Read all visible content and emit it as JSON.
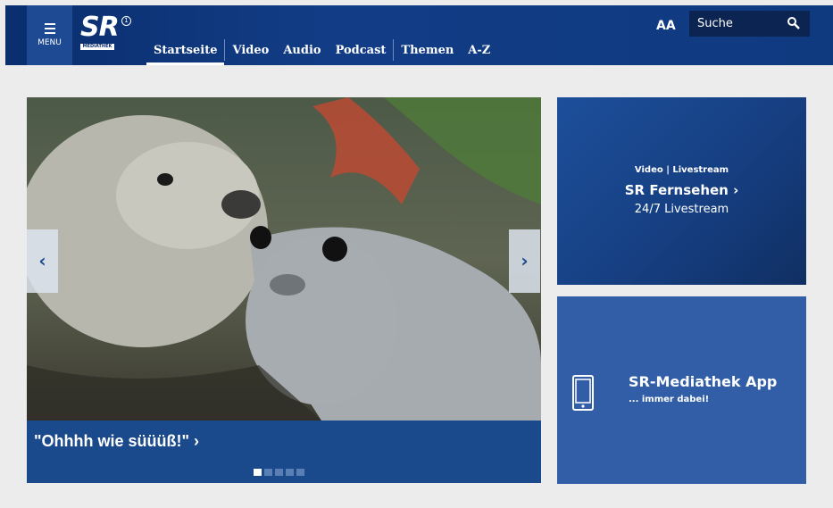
{
  "header": {
    "menu_label": "MENU",
    "logo_text": "SR",
    "logo_sub": "MEDIATHEK",
    "nav": [
      "Startseite",
      "Video",
      "Audio",
      "Podcast",
      "Themen",
      "A-Z"
    ],
    "font_toggle": "AA",
    "search_placeholder": "Suche",
    "brand_color": "#0f3a80"
  },
  "slider": {
    "caption": "\"Ohhhh wie süüüß!\" ›",
    "slide_count": 5,
    "active_slide": 1,
    "prev_icon": "chevron-left-icon",
    "next_icon": "chevron-right-icon"
  },
  "tiles": {
    "livestream": {
      "kicker": "Video | Livestream",
      "title": "SR Fernsehen ›",
      "subtitle": "24/7 Livestream"
    },
    "app": {
      "icon": "smartphone-icon",
      "title": "SR-Mediathek App",
      "subtitle": "... immer dabei!"
    }
  }
}
